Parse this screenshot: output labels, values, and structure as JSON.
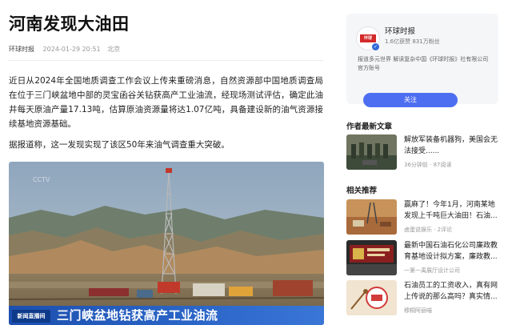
{
  "article": {
    "title": "河南发现大油田",
    "source": "环球时报",
    "time": "2024-01-29 20:51",
    "location": "北京",
    "paragraphs": [
      "近日从2024年全国地质调查工作会议上传来重磅消息，自然资源部中国地质调查局在位于三门峡盆地中部的灵宝函谷关钻获高产工业油流，经现场测试评估，确定此油井每天原油产量17.13吨，估算原油资源量将达1.07亿吨，具备建设新的油气资源接续基地资源基础。",
      "据报道称，这一发现实现了该区50年来油气调查重大突破。"
    ],
    "image": {
      "caption": "三门峡盆地钻获高产工业油流",
      "channel_logo": "新闻直播间",
      "watermark": "CCTV"
    }
  },
  "sidebar": {
    "account": {
      "name": "环球时报",
      "stats": "1.6亿获赞 831万粉丝",
      "description": "报道多元世界 解读复杂中国《环球时报》社有限公司官方账号",
      "follow_label": "关注"
    },
    "author_news_title": "作者最新文章",
    "author_news": [
      {
        "title": "解放军装备机器狗，美国会无法接受......",
        "meta": "36分钟前 · 87阅读"
      }
    ],
    "related_title": "相关推荐",
    "related": [
      {
        "title": "赢麻了！今年1月，河南某地发现上千吨巨大油田！石油...",
        "meta": "卤蛋说娱乐 · 2评论"
      },
      {
        "title": "最新中国石油石化公司廉政教育基地设计拟方案，廉政教...",
        "meta": "一第一禹展厅设计公司"
      },
      {
        "title": "石油员工的工资收入，真有网上传说的那么高吗？真实情...",
        "meta": "穆桐阿丽喵"
      }
    ]
  },
  "colors": {
    "accent": "#4e6ef2",
    "caption_bar": "#2b66c8",
    "stamp": "#d32a2a"
  }
}
